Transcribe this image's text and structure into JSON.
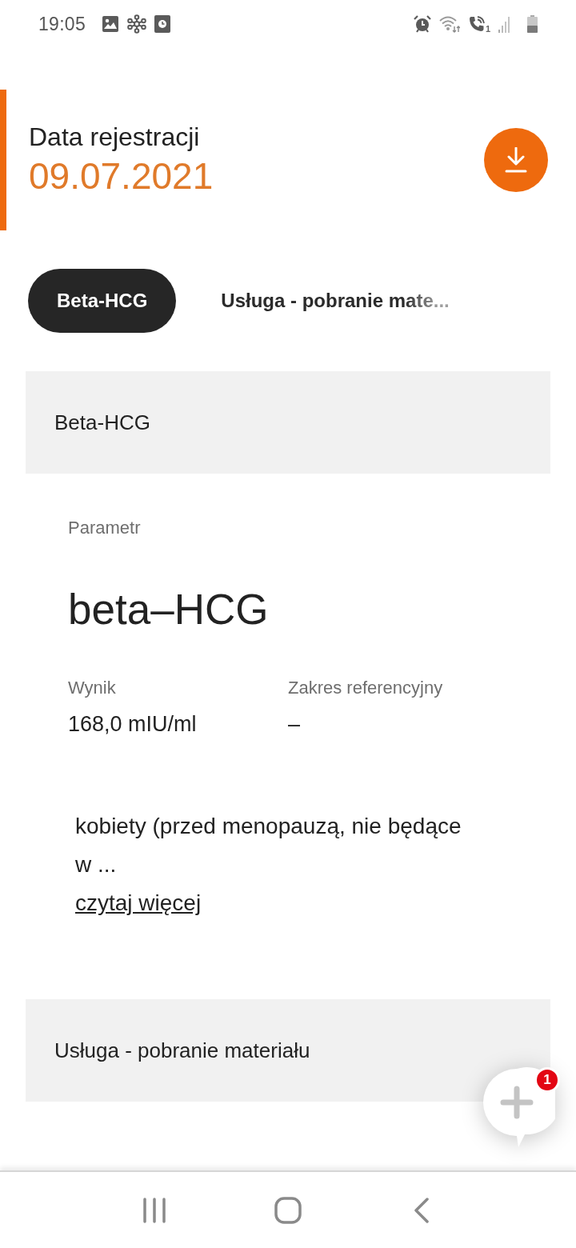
{
  "status_bar": {
    "time": "19:05",
    "sim_slot": "1"
  },
  "header": {
    "title": "Data rejestracji",
    "date": "09.07.2021"
  },
  "tabs": [
    {
      "label": "Beta-HCG",
      "selected": true
    },
    {
      "label": "Usługa - pobranie mate...",
      "selected": false
    }
  ],
  "sections": [
    {
      "title": "Beta-HCG",
      "details": {
        "parameter_label": "Parametr",
        "parameter": "beta–HCG",
        "result_label": "Wynik",
        "result": "168,0 mIU/ml",
        "range_label": "Zakres referencyjny",
        "range": "–",
        "note": "kobiety (przed menopauzą, nie będące w ...",
        "more_link": "czytaj więcej"
      }
    },
    {
      "title": "Usługa - pobranie materiału"
    }
  ],
  "chat_button": {
    "badge": "1"
  }
}
